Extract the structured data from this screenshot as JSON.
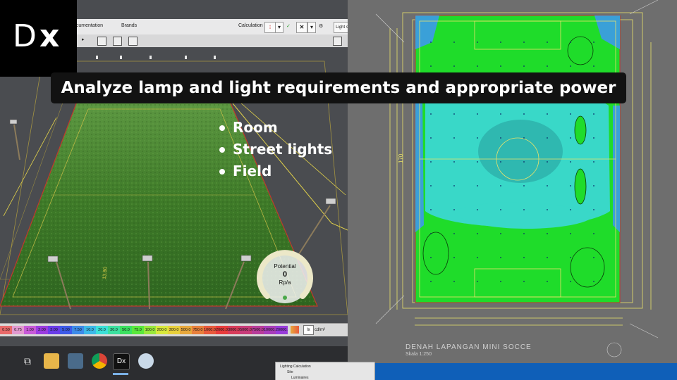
{
  "logo": {
    "d": "D",
    "x": "x"
  },
  "banner": {
    "text": "Analyze lamp and light requirements and appropriate power"
  },
  "bullets": [
    "Room",
    "Street lights",
    "Field"
  ],
  "toolbar": {
    "documentation": "ocumentation",
    "brands": "Brands",
    "calculation": "Calculation",
    "light_tab": "Light s"
  },
  "gauge": {
    "label": "Potential",
    "value": "0",
    "unit": "Rp/a"
  },
  "legend": {
    "values": [
      "0.50",
      "0.75",
      "1.00",
      "2.00",
      "3.00",
      "5.00",
      "7.50",
      "10.0",
      "20.0",
      "30.0",
      "50.0",
      "75.0",
      "100.0",
      "200.0",
      "300.0",
      "500.0",
      "750.0",
      "1000.0",
      "2000.0",
      "3000.0",
      "5000.0",
      "7500.0",
      "10000.0",
      "20000.0"
    ],
    "lx_button": "lx",
    "unit": "cd/m²"
  },
  "plan": {
    "title": "DENAH LAPANGAN MINI SOCCE",
    "scale": "Skala 1:250",
    "dim_left": "170"
  },
  "taskbar": {
    "apps": [
      "task-view",
      "file-explorer",
      "photos",
      "chrome",
      "dx-app",
      "paint"
    ],
    "dx_label": "Dx"
  },
  "mini_panel": {
    "row1": "Lighting Calculation",
    "row2": "Site",
    "row3": "Luminaires"
  },
  "colors": {
    "banner_bg": "#121212",
    "turf": "#3f7b2a",
    "contour_green": "#1fdc2a",
    "contour_cyan": "#39d8c8",
    "contour_blue": "#3aa0d8",
    "taskbar": "#2c2d30"
  }
}
